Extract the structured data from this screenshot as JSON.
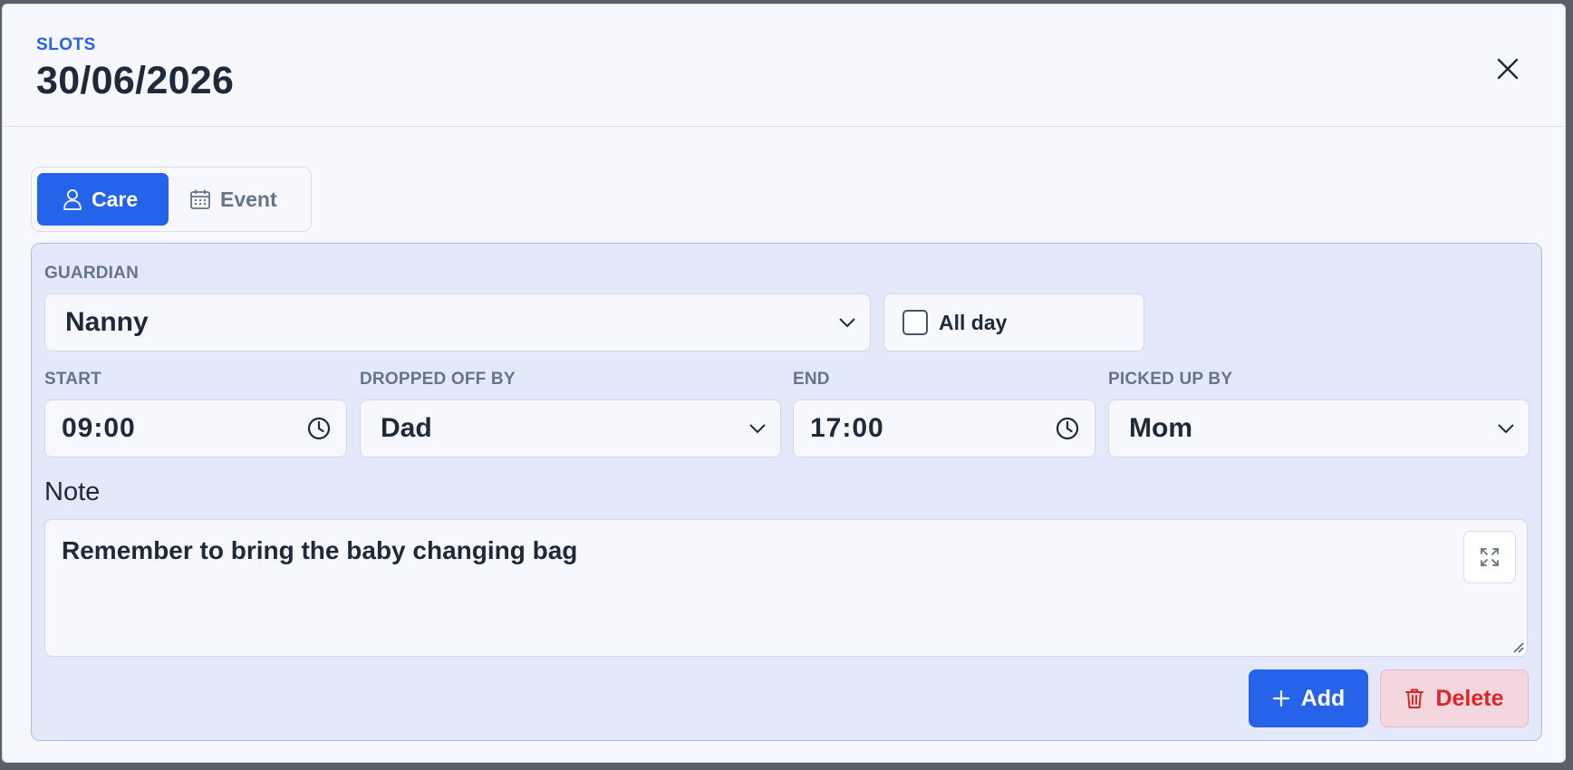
{
  "header": {
    "eyebrow": "SLOTS",
    "title": "30/06/2026",
    "close_icon": "close-icon"
  },
  "tabs": [
    {
      "label": "Care",
      "icon": "person-icon",
      "active": true
    },
    {
      "label": "Event",
      "icon": "calendar-icon",
      "active": false
    }
  ],
  "form": {
    "guardian_label": "GUARDIAN",
    "guardian_value": "Nanny",
    "all_day_label": "All day",
    "all_day_checked": false,
    "start_label": "START",
    "start_value": "09:00",
    "dropped_off_label": "DROPPED OFF BY",
    "dropped_off_value": "Dad",
    "end_label": "END",
    "end_value": "17:00",
    "picked_up_label": "PICKED UP BY",
    "picked_up_value": "Mom",
    "note_label": "Note",
    "note_value": "Remember to bring the baby changing bag"
  },
  "actions": {
    "add_label": "Add",
    "delete_label": "Delete"
  },
  "colors": {
    "accent": "#2563eb",
    "danger": "#dc2626",
    "panel_bg": "#e3e9fb"
  }
}
